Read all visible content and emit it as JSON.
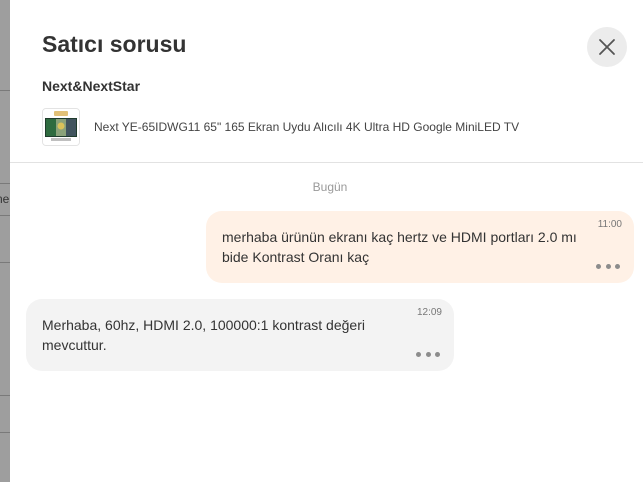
{
  "modal": {
    "title": "Satıcı sorusu",
    "close_icon": "close-icon"
  },
  "seller": {
    "name": "Next&NextStar"
  },
  "product": {
    "name": "Next YE-65IDWG11 65\" 165 Ekran Uydu Alıcılı 4K Ultra HD Google MiniLED TV",
    "thumbnail_icon": "tv-product-image"
  },
  "conversation": {
    "date_label": "Bugün",
    "messages": [
      {
        "direction": "outgoing",
        "time": "11:00",
        "line1": "merhaba ürünün ekranı kaç hertz ve HDMI portları 2.0 mı",
        "line2": "bide Kontrast Oranı kaç"
      },
      {
        "direction": "incoming",
        "time": "12:09",
        "line1": "Merhaba, 60hz, HDMI 2.0, 100000:1 kontrast değeri",
        "line2": "mevcuttur."
      }
    ]
  },
  "background": {
    "cut_text": "ne"
  },
  "colors": {
    "outgoing_bubble": "#fff1e6",
    "incoming_bubble": "#f3f3f3",
    "close_button_bg": "#ececec",
    "overlay": "#8a8a8a"
  }
}
